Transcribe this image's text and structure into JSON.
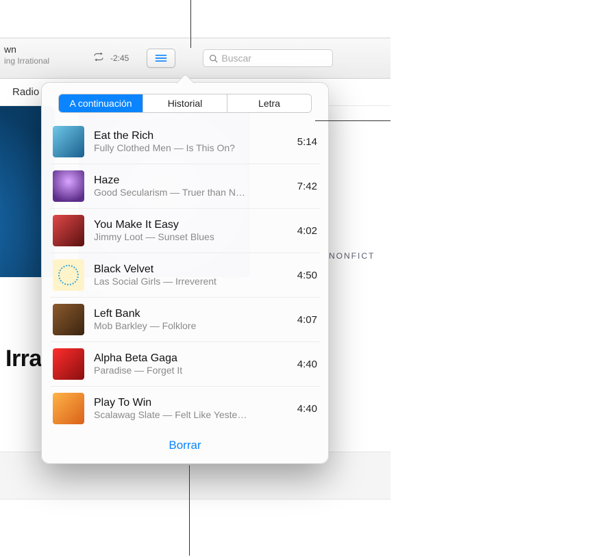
{
  "now_playing": {
    "title_fragment": "wn",
    "subtitle_fragment": "ing Irrational",
    "time_remaining": "-2:45"
  },
  "search": {
    "placeholder": "Buscar"
  },
  "nav": {
    "radio_label": "Radio"
  },
  "background": {
    "art2_meta": "NONFICT",
    "art2_label_fragment": "iction",
    "truncated_title_fragment": "Irra"
  },
  "popover": {
    "tabs": [
      {
        "label": "A continuación",
        "active": true
      },
      {
        "label": "Historial",
        "active": false
      },
      {
        "label": "Letra",
        "active": false
      }
    ],
    "queue": [
      {
        "title": "Eat the Rich",
        "artist_album": "Fully Clothed Men — Is This On?",
        "duration": "5:14",
        "thumb": "th1"
      },
      {
        "title": "Haze",
        "artist_album": "Good Secularism — Truer than N…",
        "duration": "7:42",
        "thumb": "th2"
      },
      {
        "title": "You Make It Easy",
        "artist_album": "Jimmy Loot — Sunset Blues",
        "duration": "4:02",
        "thumb": "th3"
      },
      {
        "title": "Black Velvet",
        "artist_album": "Las Social Girls — Irreverent",
        "duration": "4:50",
        "thumb": "th4"
      },
      {
        "title": "Left Bank",
        "artist_album": "Mob Barkley — Folklore",
        "duration": "4:07",
        "thumb": "th5"
      },
      {
        "title": "Alpha Beta Gaga",
        "artist_album": "Paradise — Forget It",
        "duration": "4:40",
        "thumb": "th6"
      },
      {
        "title": "Play To Win",
        "artist_album": "Scalawag Slate — Felt Like Yeste…",
        "duration": "4:40",
        "thumb": "th7"
      }
    ],
    "clear_label": "Borrar"
  }
}
